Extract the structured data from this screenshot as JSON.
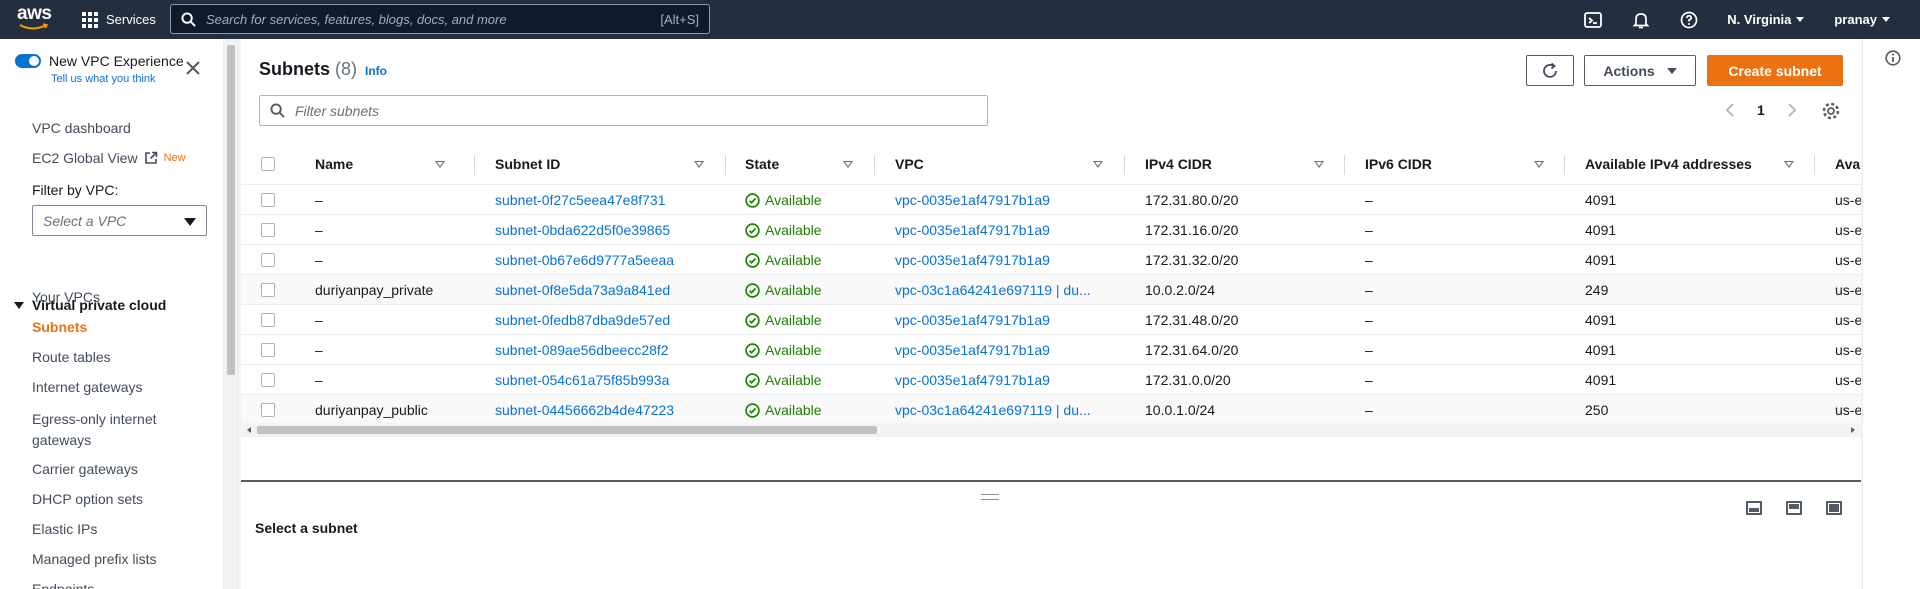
{
  "topnav": {
    "logo": "aws",
    "services": "Services",
    "search_placeholder": "Search for services, features, blogs, docs, and more",
    "search_shortcut": "[Alt+S]",
    "region": "N. Virginia",
    "user": "pranay",
    "icons": [
      "cloudshell-icon",
      "bell-icon",
      "help-icon"
    ]
  },
  "sidebar": {
    "experience_label": "New VPC Experience",
    "experience_link": "Tell us what you think",
    "vpc_dashboard": "VPC dashboard",
    "ec2_global_view": "EC2 Global View",
    "new_badge": "New",
    "filter_label": "Filter by VPC:",
    "filter_placeholder": "Select a VPC",
    "section": "Virtual private cloud",
    "items": [
      "Your VPCs",
      "Subnets",
      "Route tables",
      "Internet gateways",
      "Egress-only internet",
      "gateways",
      "Carrier gateways",
      "DHCP option sets",
      "Elastic IPs",
      "Managed prefix lists",
      "Endpoints"
    ],
    "active": "Subnets"
  },
  "main": {
    "title": "Subnets",
    "count": "(8)",
    "info": "Info",
    "actions": "Actions",
    "create": "Create subnet",
    "filter_placeholder": "Filter subnets",
    "page": "1"
  },
  "table": {
    "columns": [
      "Name",
      "Subnet ID",
      "State",
      "VPC",
      "IPv4 CIDR",
      "IPv6 CIDR",
      "Available IPv4 addresses",
      "Avai"
    ],
    "rows": [
      {
        "name": "–",
        "id": "subnet-0f27c5eea47e8f731",
        "state": "Available",
        "vpc": "vpc-0035e1af47917b1a9",
        "ipv4": "172.31.80.0/20",
        "ipv6": "–",
        "avail": "4091",
        "az": "us-ea"
      },
      {
        "name": "–",
        "id": "subnet-0bda622d5f0e39865",
        "state": "Available",
        "vpc": "vpc-0035e1af47917b1a9",
        "ipv4": "172.31.16.0/20",
        "ipv6": "–",
        "avail": "4091",
        "az": "us-ea"
      },
      {
        "name": "–",
        "id": "subnet-0b67e6d9777a5eeaa",
        "state": "Available",
        "vpc": "vpc-0035e1af47917b1a9",
        "ipv4": "172.31.32.0/20",
        "ipv6": "–",
        "avail": "4091",
        "az": "us-ea"
      },
      {
        "name": "duriyanpay_private",
        "id": "subnet-0f8e5da73a9a841ed",
        "state": "Available",
        "vpc": "vpc-03c1a64241e697119 | du...",
        "ipv4": "10.0.2.0/24",
        "ipv6": "–",
        "avail": "249",
        "az": "us-ea"
      },
      {
        "name": "–",
        "id": "subnet-0fedb87dba9de57ed",
        "state": "Available",
        "vpc": "vpc-0035e1af47917b1a9",
        "ipv4": "172.31.48.0/20",
        "ipv6": "–",
        "avail": "4091",
        "az": "us-ea"
      },
      {
        "name": "–",
        "id": "subnet-089ae56dbeecc28f2",
        "state": "Available",
        "vpc": "vpc-0035e1af47917b1a9",
        "ipv4": "172.31.64.0/20",
        "ipv6": "–",
        "avail": "4091",
        "az": "us-ea"
      },
      {
        "name": "–",
        "id": "subnet-054c61a75f85b993a",
        "state": "Available",
        "vpc": "vpc-0035e1af47917b1a9",
        "ipv4": "172.31.0.0/20",
        "ipv6": "–",
        "avail": "4091",
        "az": "us-ea"
      },
      {
        "name": "duriyanpay_public",
        "id": "subnet-04456662b4de47223",
        "state": "Available",
        "vpc": "vpc-03c1a64241e697119 | du...",
        "ipv4": "10.0.1.0/24",
        "ipv6": "–",
        "avail": "250",
        "az": "us-ea"
      }
    ]
  },
  "split": {
    "title": "Select a subnet"
  },
  "colors": {
    "nav_bg": "#232f3e",
    "primary": "#ec7211",
    "link": "#0972d3",
    "success": "#1d8102"
  }
}
